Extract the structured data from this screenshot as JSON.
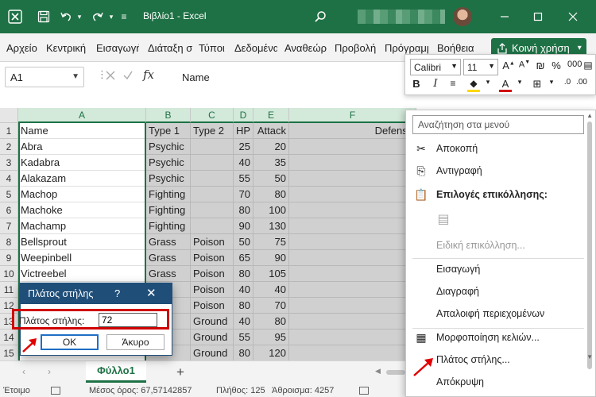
{
  "titlebar": {
    "doc_title": "Βιβλίο1  -  Excel",
    "bg": "#1e7145"
  },
  "menubar": {
    "tabs": [
      "Αρχείο",
      "Κεντρική",
      "Εισαγωγή",
      "Διάταξη σ",
      "Τύποι",
      "Δεδομένα",
      "Αναθεώρ",
      "Προβολή",
      "Πρόγραμμ",
      "Βοήθεια"
    ],
    "share_label": "Κοινή χρήση"
  },
  "formulabar": {
    "name_box": "A1",
    "fx": "fx",
    "content": "Name"
  },
  "mini_toolbar": {
    "font": "Calibri",
    "size": "11",
    "bold": "B",
    "italic": "I",
    "font_color": "A"
  },
  "grid": {
    "columns": [
      "A",
      "B",
      "C",
      "D",
      "E",
      "F"
    ],
    "rows": [
      {
        "n": "1",
        "cells": [
          "Name",
          "Type 1",
          "Type 2",
          "HP",
          "Attack",
          "Defense"
        ]
      },
      {
        "n": "2",
        "cells": [
          "Abra",
          "Psychic",
          "",
          "25",
          "20",
          ""
        ]
      },
      {
        "n": "3",
        "cells": [
          "Kadabra",
          "Psychic",
          "",
          "40",
          "35",
          ""
        ]
      },
      {
        "n": "4",
        "cells": [
          "Alakazam",
          "Psychic",
          "",
          "55",
          "50",
          ""
        ]
      },
      {
        "n": "5",
        "cells": [
          "Machop",
          "Fighting",
          "",
          "70",
          "80",
          ""
        ]
      },
      {
        "n": "6",
        "cells": [
          "Machoke",
          "Fighting",
          "",
          "80",
          "100",
          ""
        ]
      },
      {
        "n": "7",
        "cells": [
          "Machamp",
          "Fighting",
          "",
          "90",
          "130",
          ""
        ]
      },
      {
        "n": "8",
        "cells": [
          "Bellsprout",
          "Grass",
          "Poison",
          "50",
          "75",
          ""
        ]
      },
      {
        "n": "9",
        "cells": [
          "Weepinbell",
          "Grass",
          "Poison",
          "65",
          "90",
          ""
        ]
      },
      {
        "n": "10",
        "cells": [
          "Victreebel",
          "Grass",
          "Poison",
          "80",
          "105",
          ""
        ]
      },
      {
        "n": "11",
        "cells": [
          "",
          "ter",
          "Poison",
          "40",
          "40",
          ""
        ]
      },
      {
        "n": "12",
        "cells": [
          "",
          "ter",
          "Poison",
          "80",
          "70",
          ""
        ]
      },
      {
        "n": "13",
        "cells": [
          "",
          "",
          "Ground",
          "40",
          "80",
          "1"
        ]
      },
      {
        "n": "14",
        "cells": [
          "",
          "",
          "Ground",
          "55",
          "95",
          "1"
        ]
      },
      {
        "n": "15",
        "cells": [
          "",
          "",
          "Ground",
          "80",
          "120",
          "1"
        ]
      }
    ]
  },
  "sheetbar": {
    "sheet_name": "Φύλλο1",
    "add": "+"
  },
  "status": {
    "ready": "Έτοιμο",
    "average": "Μέσος όρος: 67,57142857",
    "count": "Πλήθος: 125",
    "sum": "Άθροισμα: 4257"
  },
  "context_menu": {
    "search_placeholder": "Αναζήτηση στα μενού",
    "cut": "Αποκοπή",
    "copy": "Αντιγραφή",
    "paste_options": "Επιλογές επικόλλησης:",
    "paste_special": "Ειδική επικόλληση...",
    "insert": "Εισαγωγή",
    "delete": "Διαγραφή",
    "clear_contents": "Απαλοιφή περιεχομένων",
    "format_cells": "Μορφοποίηση κελιών...",
    "column_width": "Πλάτος στήλης...",
    "hide": "Απόκρυψη"
  },
  "dialog": {
    "title": "Πλάτος στήλης",
    "help": "?",
    "close": "✕",
    "label": "Πλάτος στήλης:",
    "value": "72",
    "ok": "OK",
    "cancel": "Άκυρο"
  },
  "colors": {
    "excel_green": "#1e7145",
    "dialog_blue": "#1f4e79",
    "highlight_red": "#d00000"
  }
}
